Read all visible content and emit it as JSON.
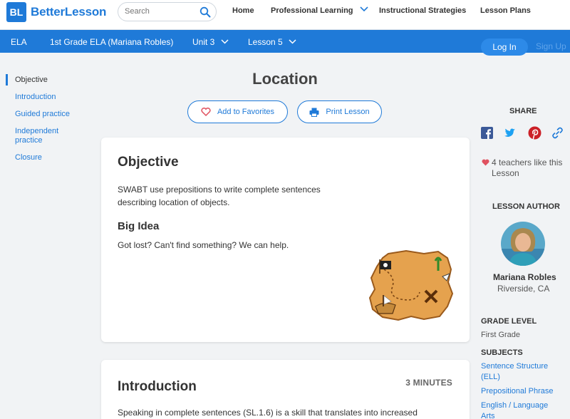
{
  "header": {
    "logo_mark": "BL",
    "brand": "BetterLesson",
    "search_placeholder": "Search",
    "nav": [
      "Home",
      "Professional Learning",
      "Instructional Strategies",
      "Lesson Plans"
    ]
  },
  "course_bar": {
    "subject": "ELA",
    "course": "1st Grade ELA (Mariana Robles)",
    "unit": "Unit 3",
    "lesson": "Lesson 5",
    "login": "Log In",
    "signup": "Sign Up"
  },
  "side_nav": [
    "Objective",
    "Introduction",
    "Guided practice",
    "Independent practice",
    "Closure"
  ],
  "lesson": {
    "title": "Location",
    "add_favorites": "Add to Favorites",
    "print": "Print Lesson"
  },
  "objective_card": {
    "heading": "Objective",
    "text": "SWABT use prepositions to write complete sentences describing location of objects.",
    "big_idea_heading": "Big Idea",
    "big_idea_text": "Got lost? Can't find something? We can help."
  },
  "intro_card": {
    "heading": "Introduction",
    "minutes": "3 MINUTES",
    "text": "Speaking in complete sentences (SL.1.6) is a skill that translates into increased"
  },
  "sidebar": {
    "share_label": "SHARE",
    "likes": "4 teachers like this Lesson",
    "author_label": "LESSON AUTHOR",
    "author_name": "Mariana Robles",
    "author_location": "Riverside, CA",
    "grade_label": "GRADE LEVEL",
    "grade": "First Grade",
    "subjects_label": "SUBJECTS",
    "subjects": [
      "Sentence Structure (ELL)",
      "Prepositional Phrase",
      "English / Language Arts"
    ]
  },
  "colors": {
    "brand": "#1f7ad8",
    "heart": "#e05260",
    "facebook": "#3b5998",
    "twitter": "#1da1f2",
    "pinterest": "#cb2027"
  },
  "icons": [
    "search-icon",
    "chevron-down-icon",
    "heart-icon",
    "printer-icon",
    "facebook-icon",
    "twitter-icon",
    "pinterest-icon",
    "link-icon"
  ]
}
